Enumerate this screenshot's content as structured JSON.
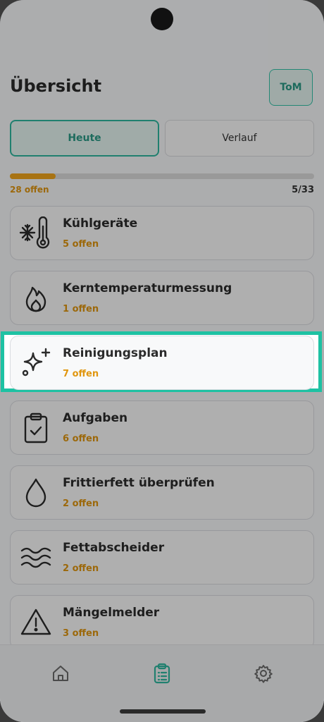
{
  "header": {
    "title": "Übersicht",
    "avatar_initials": "ToM"
  },
  "tabs": [
    {
      "label": "Heute",
      "active": true
    },
    {
      "label": "Verlauf",
      "active": false
    }
  ],
  "progress": {
    "open_label": "28 offen",
    "ratio_label": "5/33",
    "completed": 5,
    "total": 33,
    "color": "#f1a51c"
  },
  "items": [
    {
      "name": "Kühlgeräte",
      "count": "5 offen",
      "icon": "thermometer-snowflake-icon"
    },
    {
      "name": "Kerntemperaturmessung",
      "count": "1 offen",
      "icon": "flame-icon"
    },
    {
      "name": "Reinigungsplan",
      "count": "7 offen",
      "icon": "sparkles-icon",
      "highlighted": true
    },
    {
      "name": "Aufgaben",
      "count": "6 offen",
      "icon": "clipboard-check-icon"
    },
    {
      "name": "Frittierfett überprüfen",
      "count": "2 offen",
      "icon": "droplet-icon"
    },
    {
      "name": "Fettabscheider",
      "count": "2 offen",
      "icon": "waves-icon"
    },
    {
      "name": "Mängelmelder",
      "count": "3 offen",
      "icon": "warning-triangle-icon"
    }
  ],
  "bottom_nav": [
    {
      "icon": "home-icon",
      "active": false
    },
    {
      "icon": "clipboard-list-icon",
      "active": true
    },
    {
      "icon": "settings-gear-icon",
      "active": false
    }
  ],
  "colors": {
    "accent": "#2fb89f",
    "highlight_border": "#1ec2a3",
    "count": "#e0960f"
  }
}
